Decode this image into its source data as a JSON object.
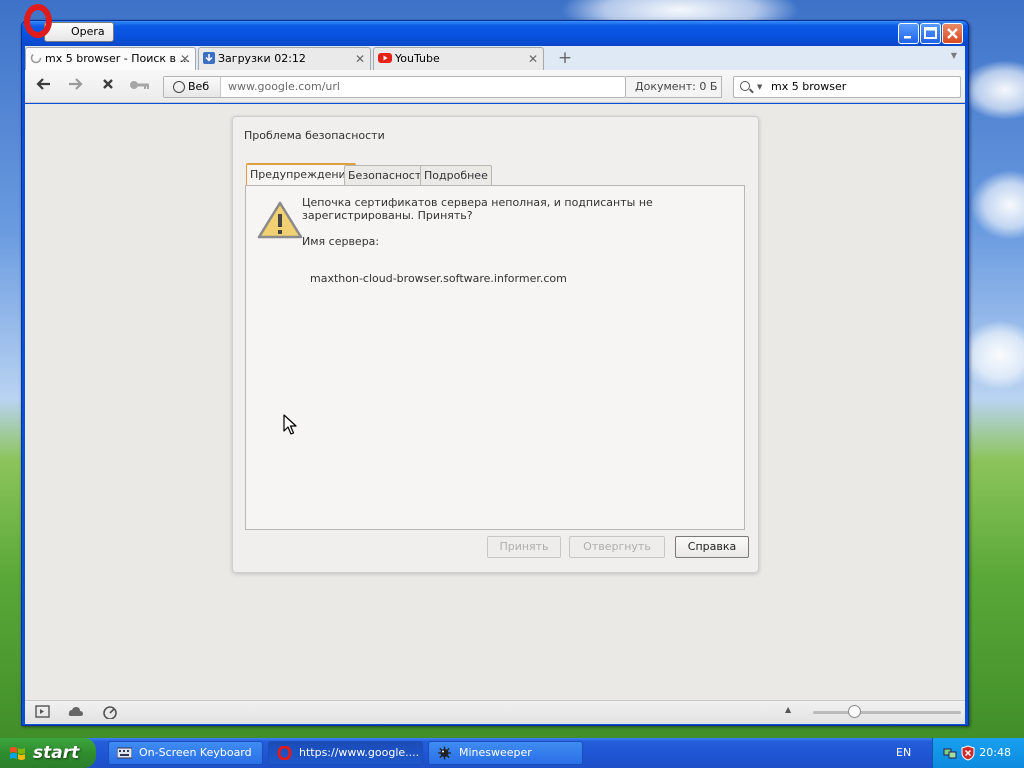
{
  "browser": {
    "menu_label": "Opera",
    "tabs": [
      {
        "label": "mx 5 browser - Поиск в ...",
        "close": "✕"
      },
      {
        "label": "Загрузки 02:12",
        "close": "✕"
      },
      {
        "label": "YouTube",
        "close": "✕"
      }
    ],
    "new_tab": "+",
    "address": {
      "badge": "Веб",
      "url": "www.google.com/url"
    },
    "document_size": "Документ:   0 Б",
    "search": {
      "value": "mx 5 browser"
    }
  },
  "dialog": {
    "title": "Проблема безопасности",
    "tabs": [
      "Предупреждение",
      "Безопасность",
      "Подробнее"
    ],
    "message": "Цепочка сертификатов сервера неполная, и подписанты не зарегистрированы. Принять?",
    "server_label": "Имя сервера:",
    "server_name": "maxthon-cloud-browser.software.informer.com",
    "buttons": {
      "accept": "Принять",
      "reject": "Отвергнуть",
      "help": "Справка"
    }
  },
  "taskbar": {
    "start": "start",
    "tasks": [
      {
        "label": "On-Screen Keyboard"
      },
      {
        "label": "https://www.google...."
      },
      {
        "label": "Minesweeper"
      }
    ],
    "language": "EN",
    "clock": "20:48"
  },
  "colors": {
    "opera_red": "#e01b1b",
    "xp_blue": "#245edb",
    "start_green": "#2f8e2f",
    "warning_yellow": "#f0d070"
  }
}
